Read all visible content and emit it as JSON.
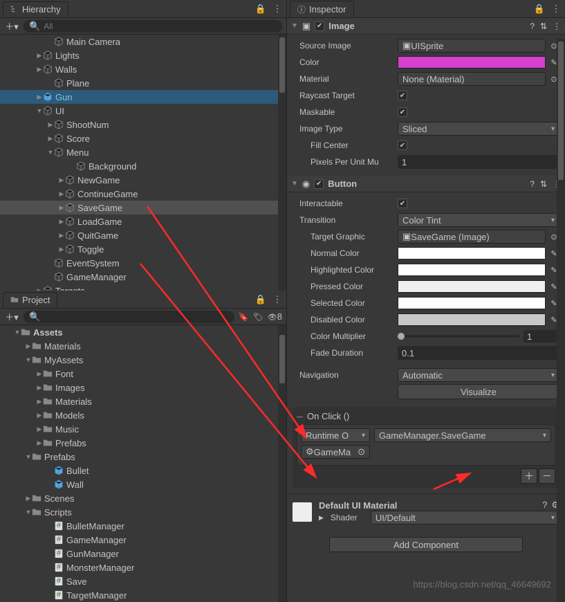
{
  "hierarchy": {
    "tab": "Hierarchy",
    "search_placeholder": "All",
    "items": [
      {
        "level": 4,
        "arrow": "",
        "kind": "cube",
        "label": "Main Camera"
      },
      {
        "level": 3,
        "arrow": "▶",
        "kind": "cube",
        "label": "Lights"
      },
      {
        "level": 3,
        "arrow": "▶",
        "kind": "cube",
        "label": "Walls"
      },
      {
        "level": 4,
        "arrow": "",
        "kind": "cube",
        "label": "Plane"
      },
      {
        "level": 3,
        "arrow": "▶",
        "kind": "prefab",
        "label": "Gun",
        "cyan": true,
        "sel": "sel"
      },
      {
        "level": 3,
        "arrow": "▼",
        "kind": "cube",
        "label": "UI"
      },
      {
        "level": 4,
        "arrow": "▶",
        "kind": "cube",
        "label": "ShootNum"
      },
      {
        "level": 4,
        "arrow": "▶",
        "kind": "cube",
        "label": "Score"
      },
      {
        "level": 4,
        "arrow": "▼",
        "kind": "cube",
        "label": "Menu"
      },
      {
        "level": 6,
        "arrow": "",
        "kind": "cube",
        "label": "Background"
      },
      {
        "level": 5,
        "arrow": "▶",
        "kind": "cube",
        "label": "NewGame"
      },
      {
        "level": 5,
        "arrow": "▶",
        "kind": "cube",
        "label": "ContinueGame"
      },
      {
        "level": 5,
        "arrow": "▶",
        "kind": "cube",
        "label": "SaveGame",
        "sel": "sel2"
      },
      {
        "level": 5,
        "arrow": "▶",
        "kind": "cube",
        "label": "LoadGame"
      },
      {
        "level": 5,
        "arrow": "▶",
        "kind": "cube",
        "label": "QuitGame"
      },
      {
        "level": 5,
        "arrow": "▶",
        "kind": "cube",
        "label": "Toggle"
      },
      {
        "level": 4,
        "arrow": "",
        "kind": "cube",
        "label": "EventSystem"
      },
      {
        "level": 4,
        "arrow": "",
        "kind": "cube",
        "label": "GameManager"
      },
      {
        "level": 3,
        "arrow": "▶",
        "kind": "cube",
        "label": "Targets"
      }
    ]
  },
  "project": {
    "tab": "Project",
    "badge": "8",
    "items": [
      {
        "level": 1,
        "arrow": "▼",
        "kind": "folder",
        "label": "Assets",
        "bold": true
      },
      {
        "level": 2,
        "arrow": "▶",
        "kind": "folder",
        "label": "Materials"
      },
      {
        "level": 2,
        "arrow": "▼",
        "kind": "folder",
        "label": "MyAssets"
      },
      {
        "level": 3,
        "arrow": "▶",
        "kind": "folder",
        "label": "Font"
      },
      {
        "level": 3,
        "arrow": "▶",
        "kind": "folder",
        "label": "Images"
      },
      {
        "level": 3,
        "arrow": "▶",
        "kind": "folder",
        "label": "Materials"
      },
      {
        "level": 3,
        "arrow": "▶",
        "kind": "folder",
        "label": "Models"
      },
      {
        "level": 3,
        "arrow": "▶",
        "kind": "folder",
        "label": "Music"
      },
      {
        "level": 3,
        "arrow": "▶",
        "kind": "folder",
        "label": "Prefabs"
      },
      {
        "level": 2,
        "arrow": "▼",
        "kind": "folder",
        "label": "Prefabs"
      },
      {
        "level": 4,
        "arrow": "",
        "kind": "prefab",
        "label": "Bullet"
      },
      {
        "level": 4,
        "arrow": "",
        "kind": "prefab",
        "label": "Wall"
      },
      {
        "level": 2,
        "arrow": "▶",
        "kind": "folder",
        "label": "Scenes"
      },
      {
        "level": 2,
        "arrow": "▼",
        "kind": "folder",
        "label": "Scripts"
      },
      {
        "level": 4,
        "arrow": "",
        "kind": "script",
        "label": "BulletManager"
      },
      {
        "level": 4,
        "arrow": "",
        "kind": "script",
        "label": "GameManager"
      },
      {
        "level": 4,
        "arrow": "",
        "kind": "script",
        "label": "GunManager"
      },
      {
        "level": 4,
        "arrow": "",
        "kind": "script",
        "label": "MonsterManager"
      },
      {
        "level": 4,
        "arrow": "",
        "kind": "script",
        "label": "Save"
      },
      {
        "level": 4,
        "arrow": "",
        "kind": "script",
        "label": "TargetManager"
      }
    ]
  },
  "inspector": {
    "tab": "Inspector",
    "image": {
      "title": "Image",
      "source_img_lbl": "Source Image",
      "source_img": "UISprite",
      "color_lbl": "Color",
      "color": "#d540cc",
      "material_lbl": "Material",
      "material": "None (Material)",
      "raycast_lbl": "Raycast Target",
      "maskable_lbl": "Maskable",
      "type_lbl": "Image Type",
      "type": "Sliced",
      "fillcenter_lbl": "Fill Center",
      "ppu_lbl": "Pixels Per Unit Mu",
      "ppu": "1"
    },
    "button": {
      "title": "Button",
      "interactable_lbl": "Interactable",
      "transition_lbl": "Transition",
      "transition": "Color Tint",
      "target_lbl": "Target Graphic",
      "target": "SaveGame (Image)",
      "normal_lbl": "Normal Color",
      "normal": "#ffffff",
      "high_lbl": "Highlighted Color",
      "high": "#ffffff",
      "pressed_lbl": "Pressed Color",
      "pressed": "#f0f0f0",
      "selected_lbl": "Selected Color",
      "selected": "#ffffff",
      "disabled_lbl": "Disabled Color",
      "disabled": "#c8c8c8",
      "mult_lbl": "Color Multiplier",
      "mult": "1",
      "fade_lbl": "Fade Duration",
      "fade": "0.1",
      "nav_lbl": "Navigation",
      "nav": "Automatic",
      "visualize": "Visualize",
      "onclick_lbl": "On Click ()",
      "runtime": "Runtime O",
      "func": "GameManager.SaveGame",
      "obj": "GameMa"
    },
    "material": {
      "name": "Default UI Material",
      "shader_lbl": "Shader",
      "shader": "UI/Default"
    },
    "addcomp": "Add Component"
  },
  "watermark": "https://blog.csdn.net/qq_46649692"
}
